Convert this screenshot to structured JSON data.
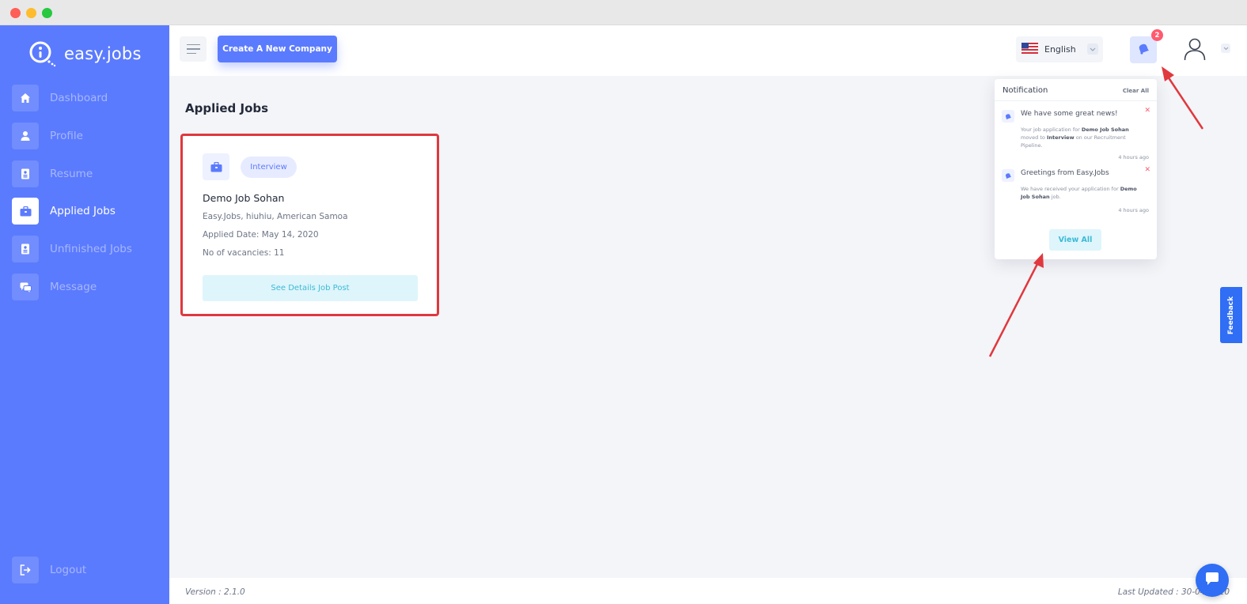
{
  "app": {
    "logo_text": "easy.jobs"
  },
  "sidebar": {
    "items": [
      {
        "label": "Dashboard",
        "icon": "home-icon"
      },
      {
        "label": "Profile",
        "icon": "user-icon"
      },
      {
        "label": "Resume",
        "icon": "document-icon"
      },
      {
        "label": "Applied Jobs",
        "icon": "briefcase-icon",
        "active": true
      },
      {
        "label": "Unfinished Jobs",
        "icon": "document-icon"
      },
      {
        "label": "Message",
        "icon": "chat-icon"
      }
    ],
    "logout_label": "Logout"
  },
  "header": {
    "create_company_label": "Create A New Company",
    "language_label": "English",
    "notification_count": "2"
  },
  "main": {
    "page_title": "Applied Jobs",
    "job": {
      "status": "Interview",
      "title": "Demo Job Sohan",
      "location": "Easy.Jobs, hiuhiu, American Samoa",
      "applied_date": "Applied Date: May 14, 2020",
      "vacancies": "No of vacancies: 11",
      "details_button": "See Details Job Post"
    }
  },
  "notifications": {
    "title": "Notification",
    "clear_all": "Clear All",
    "items": [
      {
        "title": "We have some great news!",
        "body_pre": "Your job application for",
        "body_job": "Demo Job Sohan",
        "body_mid": "moved to",
        "body_stage": "Interview",
        "body_post": "on our Recruitment Pipeline.",
        "time": "4 hours ago"
      },
      {
        "title": "Greetings from Easy.Jobs",
        "body_pre": "We have received your application for",
        "body_job": "Demo Job Sohan",
        "body_post": "job.",
        "time": "4 hours ago"
      }
    ],
    "view_all": "View All"
  },
  "feedback_label": "Feedback",
  "footer": {
    "version": "Version : 2.1.0",
    "last_updated": "Last Updated : 30-04-2020"
  },
  "colors": {
    "brand": "#5b7bfe",
    "highlight_border": "#e0383e",
    "annotation_arrow": "#e0383e",
    "accent_cyan": "#3cbad6",
    "badge": "#ff5a6e"
  }
}
